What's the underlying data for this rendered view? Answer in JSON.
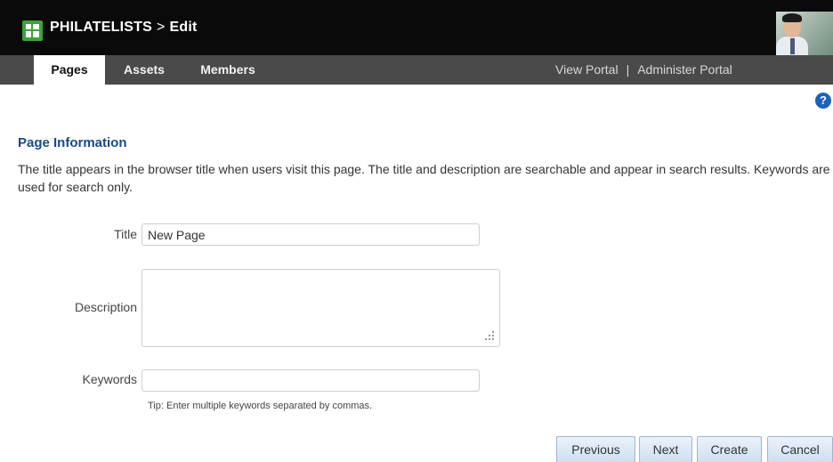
{
  "header": {
    "app_name": "PHILATELISTS",
    "separator": ">",
    "mode": "Edit",
    "logo_icon": "grid-logo-icon",
    "avatar_icon": "user-avatar"
  },
  "tabs": [
    {
      "label": "Pages",
      "active": true
    },
    {
      "label": "Assets",
      "active": false
    },
    {
      "label": "Members",
      "active": false
    }
  ],
  "portal_links": {
    "view": "View Portal",
    "divider": "|",
    "administer": "Administer Portal"
  },
  "help": {
    "icon": "help-icon",
    "glyph": "?"
  },
  "section": {
    "heading": "Page Information",
    "description": "The title appears in the browser title when users visit this page. The title and description are searchable and appear in search results. Keywords are used for search only."
  },
  "form": {
    "title_label": "Title",
    "title_value": "New Page",
    "description_label": "Description",
    "description_value": "",
    "keywords_label": "Keywords",
    "keywords_value": "",
    "tip": "Tip: Enter multiple keywords separated by commas."
  },
  "buttons": {
    "previous": "Previous",
    "next": "Next",
    "create": "Create",
    "cancel": "Cancel"
  },
  "colors": {
    "header_bg": "#0a0a0a",
    "tabbar_bg": "#4a4a4a",
    "heading": "#1a4a88",
    "logo": "#3aa53a",
    "help": "#1d63b8"
  }
}
